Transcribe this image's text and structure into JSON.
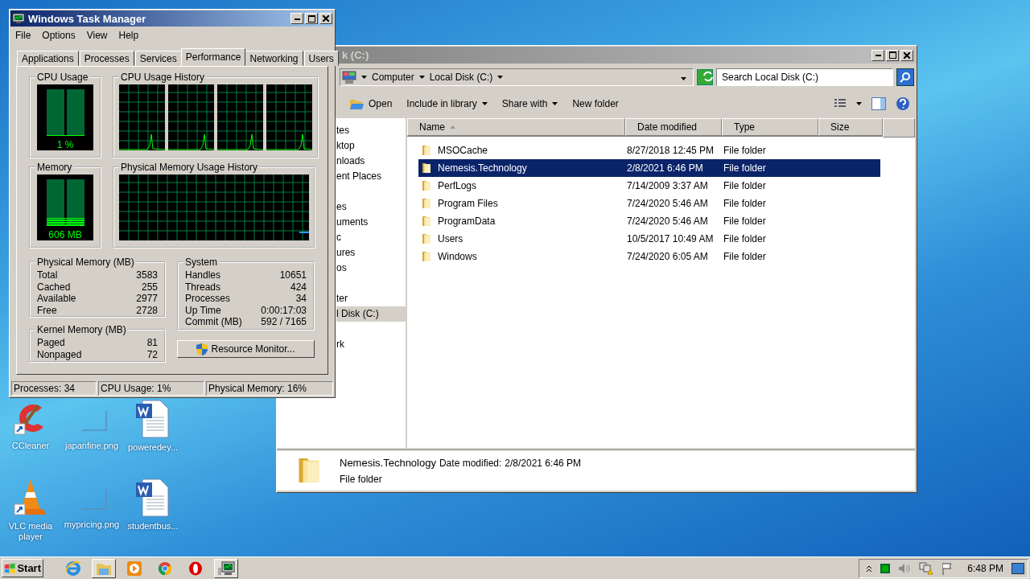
{
  "desktop": {
    "icons": [
      {
        "label": "CCleaner",
        "kind": "ccleaner"
      },
      {
        "label": "japanfine.png",
        "kind": "image"
      },
      {
        "label": "poweredey...",
        "kind": "document"
      },
      {
        "label": "VLC media player",
        "kind": "vlc"
      },
      {
        "label": "mypricing.png",
        "kind": "image"
      },
      {
        "label": "studentbus...",
        "kind": "document"
      }
    ]
  },
  "explorer": {
    "title": "k (C:)",
    "breadcrumb": [
      "Computer",
      "Local Disk (C:)"
    ],
    "search": {
      "placeholder": "Search Local Disk (C:)"
    },
    "toolbar": [
      {
        "label": "Open",
        "kind": "open"
      },
      {
        "label": "Include in library",
        "kind": "menu"
      },
      {
        "label": "Share with",
        "kind": "menu"
      },
      {
        "label": "New folder",
        "kind": "plain"
      }
    ],
    "nav_groups": [
      [
        {
          "label": "tes",
          "selected": false
        },
        {
          "label": "ktop",
          "selected": false
        },
        {
          "label": "nloads",
          "selected": false
        },
        {
          "label": "ent Places",
          "selected": false
        }
      ],
      [
        {
          "label": "es",
          "selected": false
        },
        {
          "label": "uments",
          "selected": false
        },
        {
          "label": "c",
          "selected": false
        },
        {
          "label": "ures",
          "selected": false
        },
        {
          "label": "os",
          "selected": false
        }
      ],
      [
        {
          "label": "ter",
          "selected": false
        },
        {
          "label": "l Disk (C:)",
          "selected": true
        }
      ],
      [
        {
          "label": "rk",
          "selected": false
        }
      ]
    ],
    "columns": [
      {
        "label": "Name",
        "sorted": true
      },
      {
        "label": "Date modified",
        "sorted": false
      },
      {
        "label": "Type",
        "sorted": false
      },
      {
        "label": "Size",
        "sorted": false
      }
    ],
    "rows": [
      {
        "name": "MSOCache",
        "date": "8/27/2018 12:45 PM",
        "type": "File folder",
        "selected": false
      },
      {
        "name": "Nemesis.Technology",
        "date": "2/8/2021 6:46 PM",
        "type": "File folder",
        "selected": true
      },
      {
        "name": "PerfLogs",
        "date": "7/14/2009 3:37 AM",
        "type": "File folder",
        "selected": false
      },
      {
        "name": "Program Files",
        "date": "7/24/2020 5:46 AM",
        "type": "File folder",
        "selected": false
      },
      {
        "name": "ProgramData",
        "date": "7/24/2020 5:46 AM",
        "type": "File folder",
        "selected": false
      },
      {
        "name": "Users",
        "date": "10/5/2017 10:49 AM",
        "type": "File folder",
        "selected": false
      },
      {
        "name": "Windows",
        "date": "7/24/2020 6:05 AM",
        "type": "File folder",
        "selected": false
      }
    ],
    "details": {
      "name": "Nemesis.Technology",
      "date_label": "Date modified:",
      "date": "2/8/2021 6:46 PM",
      "type": "File folder"
    }
  },
  "task_manager": {
    "title": "Windows Task Manager",
    "menu": [
      "File",
      "Options",
      "View",
      "Help"
    ],
    "tabs": [
      {
        "label": "Applications",
        "selected": false
      },
      {
        "label": "Processes",
        "selected": false
      },
      {
        "label": "Services",
        "selected": false
      },
      {
        "label": "Performance",
        "selected": true
      },
      {
        "label": "Networking",
        "selected": false
      },
      {
        "label": "Users",
        "selected": false
      }
    ],
    "cpu_usage": {
      "title": "CPU Usage",
      "level": 0.01,
      "reading": "1 %"
    },
    "cpu_history": {
      "title": "CPU Usage History"
    },
    "memory": {
      "title": "Memory",
      "level": 0.17,
      "reading": "606 MB"
    },
    "memory_history": {
      "title": "Physical Memory Usage History"
    },
    "physical_memory": {
      "title": "Physical Memory (MB)",
      "rows": [
        {
          "label": "Total",
          "value": "3583"
        },
        {
          "label": "Cached",
          "value": "255"
        },
        {
          "label": "Available",
          "value": "2977"
        },
        {
          "label": "Free",
          "value": "2728"
        }
      ]
    },
    "kernel_memory": {
      "title": "Kernel Memory (MB)",
      "rows": [
        {
          "label": "Paged",
          "value": "81"
        },
        {
          "label": "Nonpaged",
          "value": "72"
        }
      ]
    },
    "system": {
      "title": "System",
      "rows": [
        {
          "label": "Handles",
          "value": "10651"
        },
        {
          "label": "Threads",
          "value": "424"
        },
        {
          "label": "Processes",
          "value": "34"
        },
        {
          "label": "Up Time",
          "value": "0:00:17:03"
        },
        {
          "label": "Commit (MB)",
          "value": "592 / 7165"
        }
      ]
    },
    "resource_monitor_button": "Resource Monitor...",
    "status_bar": [
      "Processes: 34",
      "CPU Usage: 1%",
      "Physical Memory: 16%"
    ]
  },
  "taskbar": {
    "start": "Start",
    "pinned": [
      {
        "kind": "ie",
        "running": false
      },
      {
        "kind": "explorer",
        "running": true
      },
      {
        "kind": "media",
        "running": false
      },
      {
        "kind": "chrome",
        "running": false
      },
      {
        "kind": "opera",
        "running": false
      },
      {
        "kind": "taskmgr",
        "running": true
      }
    ],
    "clock": "6:48 PM"
  }
}
